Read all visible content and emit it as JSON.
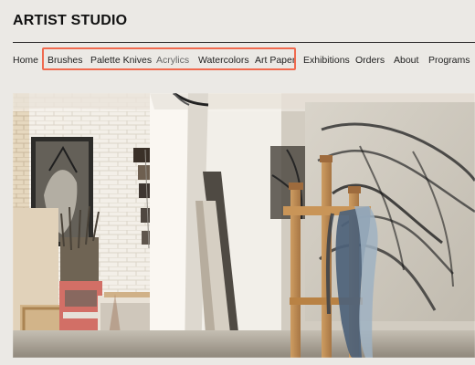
{
  "site": {
    "title": "ARTIST STUDIO"
  },
  "nav": {
    "items": [
      {
        "label": "Home"
      },
      {
        "label": "Brushes"
      },
      {
        "label": "Palette Knives"
      },
      {
        "label": "Acrylics"
      },
      {
        "label": "Watercolors"
      },
      {
        "label": "Art Paper"
      },
      {
        "label": "Exhibitions"
      },
      {
        "label": "Orders"
      },
      {
        "label": "About"
      },
      {
        "label": "Programs"
      }
    ],
    "highlight_color": "#f06a4f"
  },
  "colors": {
    "page_background": "#ebe9e5",
    "text": "#1a1a1a",
    "muted_text": "#666666"
  }
}
